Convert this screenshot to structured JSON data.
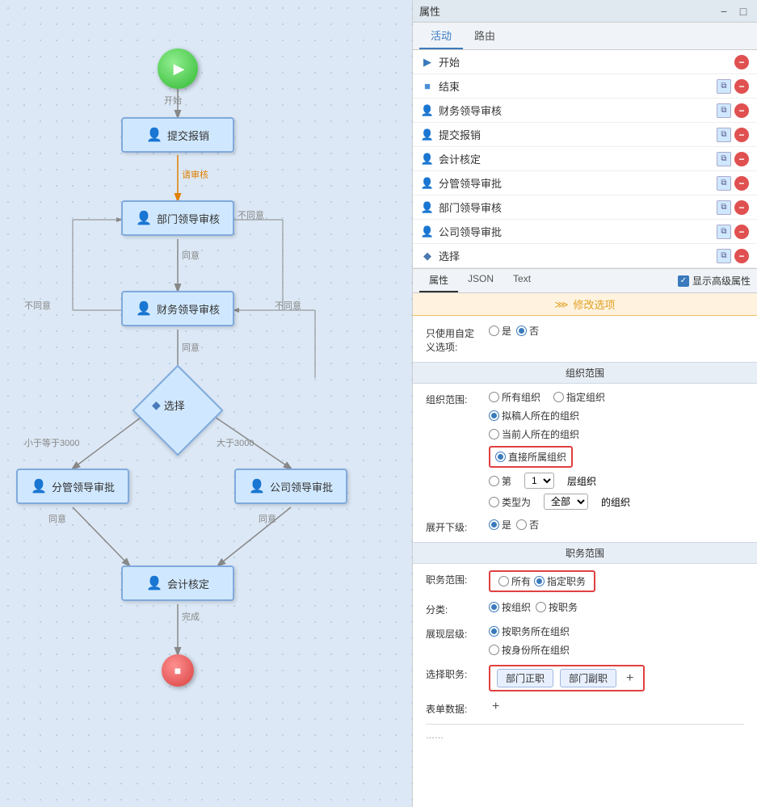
{
  "properties_panel": {
    "title": "属性",
    "tabs": {
      "activity": "活动",
      "route": "路由"
    },
    "activity_list": [
      {
        "id": "start",
        "icon": "play",
        "label": "开始",
        "has_copy": false,
        "has_delete": true
      },
      {
        "id": "end",
        "icon": "stop",
        "label": "结束",
        "has_copy": true,
        "has_delete": true
      },
      {
        "id": "finance_review",
        "icon": "user",
        "label": "财务领导审核",
        "has_copy": true,
        "has_delete": true
      },
      {
        "id": "submit_expense",
        "icon": "user",
        "label": "提交报销",
        "has_copy": true,
        "has_delete": true
      },
      {
        "id": "accounting",
        "icon": "user",
        "label": "会计核定",
        "has_copy": true,
        "has_delete": true
      },
      {
        "id": "dept_leader",
        "icon": "user",
        "label": "分管领导审批",
        "has_copy": true,
        "has_delete": true
      },
      {
        "id": "dept_review",
        "icon": "user",
        "label": "部门领导审核",
        "has_copy": true,
        "has_delete": true
      },
      {
        "id": "company_approve",
        "icon": "user",
        "label": "公司领导审批",
        "has_copy": true,
        "has_delete": true
      },
      {
        "id": "select",
        "icon": "diamond",
        "label": "选择",
        "has_copy": true,
        "has_delete": true
      }
    ],
    "bottom_tabs": [
      "属性",
      "JSON",
      "Text"
    ],
    "show_advanced": "显示高级属性",
    "edit_options_label": "修改选项",
    "form": {
      "only_custom_label": "只使用自定",
      "custom_options_label": "义选项:",
      "radio_yes": "是",
      "radio_no": "否",
      "org_range_section": "组织范围",
      "org_range_label": "组织范围:",
      "org_options": [
        {
          "id": "all_org",
          "label": "所有组织"
        },
        {
          "id": "specified_org",
          "label": "指定组织"
        },
        {
          "id": "draft_person_org",
          "label": "拟稿人所在的组织"
        },
        {
          "id": "current_person_org",
          "label": "当前人所在的组织"
        },
        {
          "id": "direct_subordinate_org",
          "label": "直接所属组织",
          "selected": true,
          "highlighted": true
        },
        {
          "id": "level_org",
          "label": "第"
        },
        {
          "id": "level_org_suffix",
          "label": "层组织"
        },
        {
          "id": "type_org_prefix",
          "label": "类型为"
        },
        {
          "id": "type_org_suffix",
          "label": "的组织"
        }
      ],
      "level_value": "1",
      "type_value": "全部",
      "expand_sub_label": "展开下级:",
      "expand_yes": "是",
      "expand_no": "否",
      "job_range_section": "职务范围",
      "job_range_label": "职务范围:",
      "job_all": "所有",
      "job_specified": "指定职务",
      "category_label": "分类:",
      "category_by_org": "按组织",
      "category_by_job": "按职务",
      "display_level_label": "展现层级:",
      "display_by_job_org": "按职务所在组织",
      "display_by_identity_org": "按身份所在组织",
      "select_job_label": "选择职务:",
      "job_tags": [
        "部门正职",
        "部门副职"
      ],
      "add_job_btn": "+",
      "form_data_label": "表单数据:",
      "add_form_btn": "+"
    }
  },
  "flowchart": {
    "nodes": [
      {
        "id": "start",
        "label": "开始",
        "type": "start"
      },
      {
        "id": "submit",
        "label": "提交报销",
        "type": "task"
      },
      {
        "id": "dept_review",
        "label": "部门领导审核",
        "type": "task"
      },
      {
        "id": "finance_review",
        "label": "财务领导审核",
        "type": "task"
      },
      {
        "id": "select",
        "label": "选择",
        "type": "diamond"
      },
      {
        "id": "dept_approve",
        "label": "分管领导审批",
        "type": "task"
      },
      {
        "id": "company_approve",
        "label": "公司领导审批",
        "type": "task"
      },
      {
        "id": "accounting",
        "label": "会计核定",
        "type": "task"
      },
      {
        "id": "end",
        "label": "",
        "type": "end"
      }
    ],
    "edge_labels": {
      "request_review": "请审核",
      "agree1": "同意",
      "disagree1": "不同意",
      "agree2": "同意",
      "disagree2": "不同意",
      "disagree3": "不同意",
      "lte3000": "小于等于3000",
      "gt3000": "大于3000",
      "agree3": "同意",
      "agree4": "同意",
      "complete": "完成"
    }
  },
  "icons": {
    "play": "▶",
    "stop": "■",
    "user": "👤",
    "diamond": "◆",
    "copy": "⧉",
    "delete": "−",
    "chevron": "⋙",
    "minus": "−",
    "window_min": "−",
    "window_close": "□"
  }
}
